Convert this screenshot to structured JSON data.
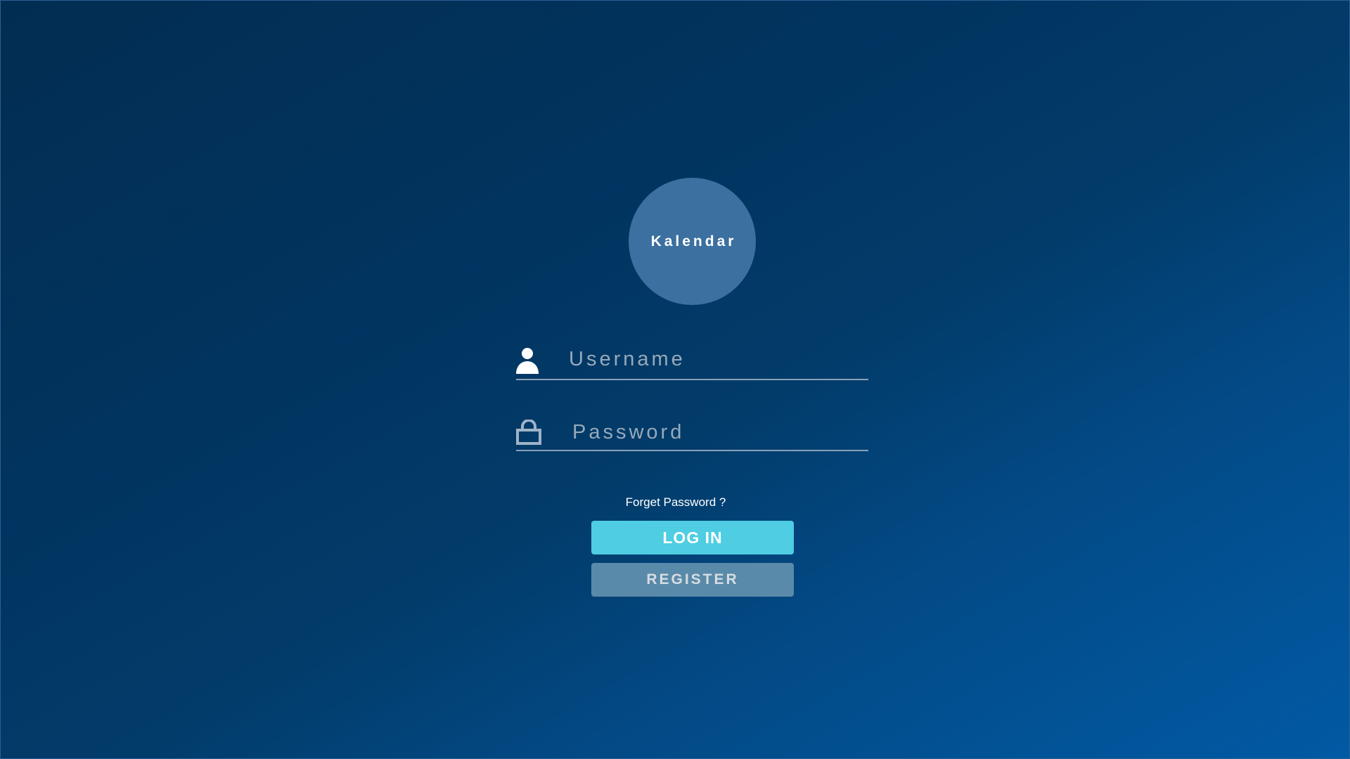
{
  "app": {
    "logo_text": "Kalendar"
  },
  "form": {
    "username": {
      "placeholder": "Username",
      "value": "",
      "icon": "user-icon"
    },
    "password": {
      "placeholder": "Password",
      "value": "",
      "icon": "lock-icon"
    },
    "forgot_label": "Forget Password ?",
    "login_label": "LOG IN",
    "register_label": "REGISTER"
  },
  "colors": {
    "background_dark": "#012e54",
    "background_light": "#015aa4",
    "logo_circle": "#3b70a0",
    "login_button": "#4ecde3",
    "register_button": "#5a8aa9",
    "field_underline": "#8aa1b7"
  }
}
